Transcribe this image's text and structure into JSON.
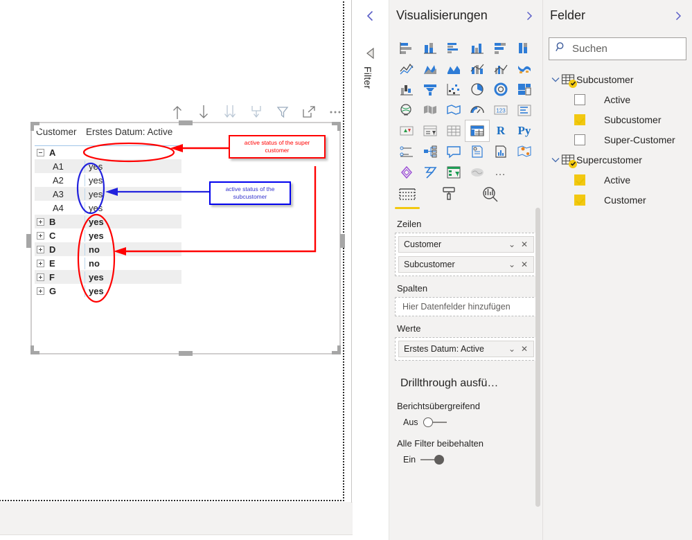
{
  "canvas": {
    "visual_toolbar": [
      {
        "name": "drill-up-icon",
        "label": "Drill up"
      },
      {
        "name": "drill-down-icon",
        "label": "Drill down"
      },
      {
        "name": "expand-all-down-icon",
        "label": "Expand all down one level"
      },
      {
        "name": "go-to-next-level-icon",
        "label": "Go to the next level"
      },
      {
        "name": "filter-icon",
        "label": "Filters"
      },
      {
        "name": "focus-mode-icon",
        "label": "Focus mode"
      },
      {
        "name": "more-options-icon",
        "label": "More options"
      }
    ],
    "matrix": {
      "columns": [
        "Customer",
        "Erstes Datum: Active"
      ],
      "rows": [
        {
          "label": "A",
          "value": "",
          "level": 1,
          "expander": "minus",
          "striped": false
        },
        {
          "label": "A1",
          "value": "yes",
          "level": 2,
          "expander": "none",
          "striped": true
        },
        {
          "label": "A2",
          "value": "yes",
          "level": 2,
          "expander": "none",
          "striped": false
        },
        {
          "label": "A3",
          "value": "yes",
          "level": 2,
          "expander": "none",
          "striped": true
        },
        {
          "label": "A4",
          "value": "yes",
          "level": 2,
          "expander": "none",
          "striped": false
        },
        {
          "label": "B",
          "value": "yes",
          "level": 1,
          "expander": "plus",
          "striped": true
        },
        {
          "label": "C",
          "value": "yes",
          "level": 1,
          "expander": "plus",
          "striped": false
        },
        {
          "label": "D",
          "value": "no",
          "level": 1,
          "expander": "plus",
          "striped": true
        },
        {
          "label": "E",
          "value": "no",
          "level": 1,
          "expander": "plus",
          "striped": false
        },
        {
          "label": "F",
          "value": "yes",
          "level": 1,
          "expander": "plus",
          "striped": true
        },
        {
          "label": "G",
          "value": "yes",
          "level": 1,
          "expander": "plus",
          "striped": false
        }
      ]
    },
    "annotations": {
      "callout_super": "active status of the super customer",
      "callout_sub": "active status of the subcustomer",
      "colors": {
        "red": "#ff0000",
        "blue": "#0000ee"
      }
    }
  },
  "filter_rail": {
    "collapse_label": "‹",
    "filter_label": "Filter"
  },
  "visualizations": {
    "title": "Visualisierungen",
    "gallery": [
      {
        "name": "stacked-bar-chart-icon"
      },
      {
        "name": "stacked-column-chart-icon"
      },
      {
        "name": "clustered-bar-chart-icon"
      },
      {
        "name": "clustered-column-chart-icon"
      },
      {
        "name": "100-stacked-bar-chart-icon"
      },
      {
        "name": "100-stacked-column-chart-icon"
      },
      {
        "name": "line-chart-icon"
      },
      {
        "name": "area-chart-icon"
      },
      {
        "name": "stacked-area-chart-icon"
      },
      {
        "name": "line-stacked-column-chart-icon"
      },
      {
        "name": "line-clustered-column-chart-icon"
      },
      {
        "name": "ribbon-chart-icon"
      },
      {
        "name": "waterfall-chart-icon"
      },
      {
        "name": "funnel-chart-icon"
      },
      {
        "name": "scatter-chart-icon"
      },
      {
        "name": "pie-chart-icon"
      },
      {
        "name": "donut-chart-icon"
      },
      {
        "name": "treemap-icon"
      },
      {
        "name": "map-icon"
      },
      {
        "name": "filled-map-icon"
      },
      {
        "name": "shape-map-icon"
      },
      {
        "name": "gauge-icon"
      },
      {
        "name": "card-icon"
      },
      {
        "name": "multi-row-card-icon"
      },
      {
        "name": "kpi-icon"
      },
      {
        "name": "slicer-icon"
      },
      {
        "name": "table-icon"
      },
      {
        "name": "matrix-icon"
      },
      {
        "name": "r-script-visual-icon",
        "text": "R"
      },
      {
        "name": "python-visual-icon",
        "text": "Py"
      },
      {
        "name": "key-influencers-icon"
      },
      {
        "name": "decomposition-tree-icon"
      },
      {
        "name": "qa-visual-icon"
      },
      {
        "name": "smart-narrative-icon"
      },
      {
        "name": "paginated-report-icon"
      },
      {
        "name": "arcgis-maps-icon"
      },
      {
        "name": "powerapps-icon"
      },
      {
        "name": "power-automate-icon"
      },
      {
        "name": "visio-icon"
      },
      {
        "name": "azure-ml-icon"
      },
      {
        "name": "get-more-visuals-icon",
        "text": "…"
      }
    ],
    "selected_visual": "matrix-icon",
    "well_tabs": [
      {
        "name": "fields-tab",
        "active": true
      },
      {
        "name": "format-tab",
        "active": false
      },
      {
        "name": "analytics-tab",
        "active": false
      }
    ],
    "wells": [
      {
        "label": "Zeilen",
        "type": "chips",
        "chips": [
          {
            "name": "Customer",
            "dropdown": "⌄",
            "remove": "✕"
          },
          {
            "name": "Subcustomer",
            "dropdown": "⌄",
            "remove": "✕"
          }
        ]
      },
      {
        "label": "Spalten",
        "type": "empty",
        "placeholder": "Hier Datenfelder hinzufügen"
      },
      {
        "label": "Werte",
        "type": "chips",
        "chips": [
          {
            "name": "Erstes Datum: Active",
            "dropdown": "⌄",
            "remove": "✕"
          }
        ]
      }
    ],
    "drillthrough": {
      "title": "Drillthrough ausfü…",
      "cross_report": {
        "label": "Berichtsübergreifend",
        "state_text": "Aus",
        "on": false
      },
      "keep_all_filters": {
        "label": "Alle Filter beibehalten",
        "state_text": "Ein",
        "on": true
      }
    }
  },
  "fields": {
    "title": "Felder",
    "search_placeholder": "Suchen",
    "tables": [
      {
        "name": "Subcustomer",
        "expanded": true,
        "items": [
          {
            "label": "Active",
            "checked": false
          },
          {
            "label": "Subcustomer",
            "checked": true
          },
          {
            "label": "Super-Customer",
            "checked": false
          }
        ]
      },
      {
        "name": "Supercustomer",
        "expanded": true,
        "items": [
          {
            "label": "Active",
            "checked": true
          },
          {
            "label": "Customer",
            "checked": true
          }
        ]
      }
    ],
    "accent_color": "#f2c811"
  }
}
